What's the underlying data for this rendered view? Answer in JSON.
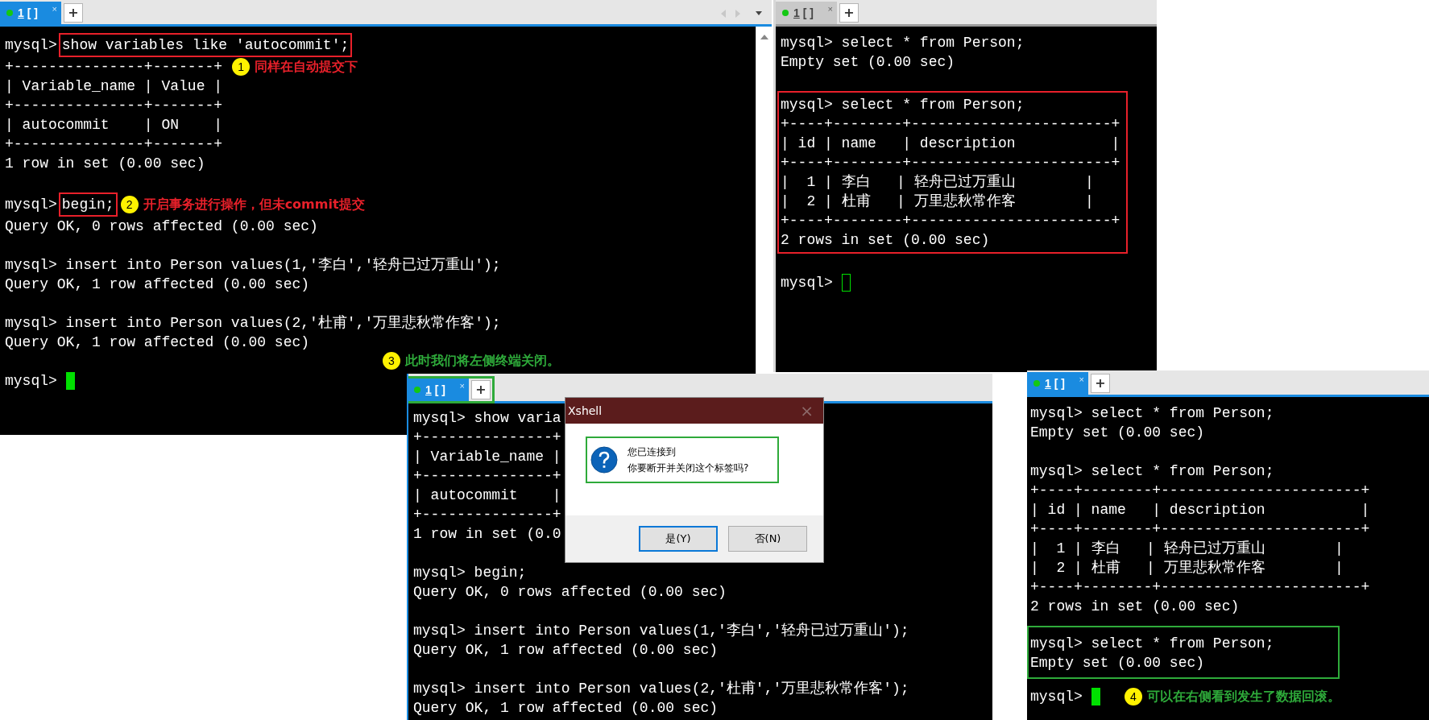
{
  "terminals": [
    {
      "focused": true,
      "tab": {
        "number": "1",
        "title": "[ ]",
        "close": "×",
        "new": "+"
      },
      "body": [
        {
          "kind": "line",
          "text": "mysql>",
          "highlight": {
            "text": "show variables like 'autocommit';",
            "color": "#e8202a"
          }
        },
        {
          "kind": "line",
          "text": "+---------------+-------+",
          "note": {
            "number": "1",
            "text": "同样在自动提交下",
            "color": "#e8202a"
          }
        },
        {
          "kind": "line",
          "text": "| Variable_name | Value |"
        },
        {
          "kind": "line",
          "text": "+---------------+-------+"
        },
        {
          "kind": "line",
          "text": "| autocommit    | ON    |"
        },
        {
          "kind": "line",
          "text": "+---------------+-------+"
        },
        {
          "kind": "line",
          "text": "1 row in set (0.00 sec)"
        },
        {
          "kind": "blank"
        },
        {
          "kind": "line",
          "text": "mysql>",
          "highlight": {
            "text": "begin;",
            "color": "#e8202a"
          },
          "note": {
            "number": "2",
            "text": "开启事务进行操作，但未commit提交",
            "color": "#e8202a"
          }
        },
        {
          "kind": "line",
          "text": "Query OK, 0 rows affected (0.00 sec)"
        },
        {
          "kind": "blank"
        },
        {
          "kind": "line",
          "text": "mysql> insert into Person values(1,'李白','轻舟已过万重山');"
        },
        {
          "kind": "line",
          "text": "Query OK, 1 row affected (0.00 sec)"
        },
        {
          "kind": "blank"
        },
        {
          "kind": "line",
          "text": "mysql> insert into Person values(2,'杜甫','万里悲秋常作客');"
        },
        {
          "kind": "line",
          "text": "Query OK, 1 row affected (0.00 sec)"
        },
        {
          "kind": "blank"
        },
        {
          "kind": "input",
          "text": "mysql>"
        }
      ]
    },
    {
      "focused": false,
      "tab": {
        "number": "1",
        "title": "[ ]",
        "close": "×",
        "new": "+"
      },
      "body": [
        {
          "kind": "line",
          "text": "mysql> select * from Person;"
        },
        {
          "kind": "line",
          "text": "Empty set (0.00 sec)"
        },
        {
          "kind": "blank"
        },
        {
          "kind": "frame",
          "color": "#e8202a",
          "lines": [
            "mysql> select * from Person;",
            "+----+--------+-----------------------+",
            "| id | name   | description           |",
            "+----+--------+-----------------------+",
            "|  1 | 李白   | 轻舟已过万重山        |",
            "|  2 | 杜甫   | 万里悲秋常作客        |",
            "+----+--------+-----------------------+",
            "2 rows in set (0.00 sec)"
          ]
        },
        {
          "kind": "blank"
        },
        {
          "kind": "input",
          "text": "mysql>"
        }
      ]
    },
    {
      "focused": true,
      "tab": {
        "number": "1",
        "title": "[ ]",
        "close": "×",
        "new": "+",
        "frame": {
          "color": "#2eaa3a"
        }
      },
      "body": [
        {
          "kind": "line",
          "text": "mysql> show varia"
        },
        {
          "kind": "line",
          "text": "+---------------+"
        },
        {
          "kind": "line",
          "text": "| Variable_name |"
        },
        {
          "kind": "line",
          "text": "+---------------+"
        },
        {
          "kind": "line",
          "text": "| autocommit    |"
        },
        {
          "kind": "line",
          "text": "+---------------+"
        },
        {
          "kind": "line",
          "text": "1 row in set (0.0"
        },
        {
          "kind": "blank"
        },
        {
          "kind": "line",
          "text": "mysql> begin;"
        },
        {
          "kind": "line",
          "text": "Query OK, 0 rows affected (0.00 sec)"
        },
        {
          "kind": "blank"
        },
        {
          "kind": "line",
          "text": "mysql> insert into Person values(1,'李白','轻舟已过万重山');"
        },
        {
          "kind": "line",
          "text": "Query OK, 1 row affected (0.00 sec)"
        },
        {
          "kind": "blank"
        },
        {
          "kind": "line",
          "text": "mysql> insert into Person values(2,'杜甫','万里悲秋常作客');"
        },
        {
          "kind": "line",
          "text": "Query OK, 1 row affected (0.00 sec)"
        }
      ]
    },
    {
      "focused": true,
      "tab": {
        "number": "1",
        "title": "[ ]",
        "close": "×",
        "new": "+"
      },
      "body": [
        {
          "kind": "line",
          "text": "mysql> select * from Person;"
        },
        {
          "kind": "line",
          "text": "Empty set (0.00 sec)"
        },
        {
          "kind": "blank"
        },
        {
          "kind": "line",
          "text": "mysql> select * from Person;"
        },
        {
          "kind": "line",
          "text": "+----+--------+-----------------------+"
        },
        {
          "kind": "line",
          "text": "| id | name   | description           |"
        },
        {
          "kind": "line",
          "text": "+----+--------+-----------------------+"
        },
        {
          "kind": "line",
          "text": "|  1 | 李白   | 轻舟已过万重山        |"
        },
        {
          "kind": "line",
          "text": "|  2 | 杜甫   | 万里悲秋常作客        |"
        },
        {
          "kind": "line",
          "text": "+----+--------+-----------------------+"
        },
        {
          "kind": "line",
          "text": "2 rows in set (0.00 sec)"
        },
        {
          "kind": "frame",
          "color": "#2eaa3a",
          "lines": [
            "mysql> select * from Person;",
            "Empty set (0.00 sec)"
          ]
        },
        {
          "kind": "input",
          "text": "mysql>",
          "note": {
            "number": "4",
            "text": "可以在右侧看到发生了数据回滚。",
            "color": "#2eaa3a"
          }
        }
      ]
    }
  ],
  "annotations": [
    {
      "number": "3",
      "text": "此时我们将左侧终端关闭。",
      "color": "#2eaa3a"
    }
  ],
  "dialog": {
    "title": "Xshell",
    "close": "×",
    "message": [
      "您已连接到",
      "你要断开并关闭这个标签吗?"
    ],
    "frame": {
      "color": "#2eaa3a"
    },
    "buttons": [
      {
        "label": "是(Y)",
        "default": true
      },
      {
        "label": "否(N)",
        "default": false
      }
    ]
  }
}
